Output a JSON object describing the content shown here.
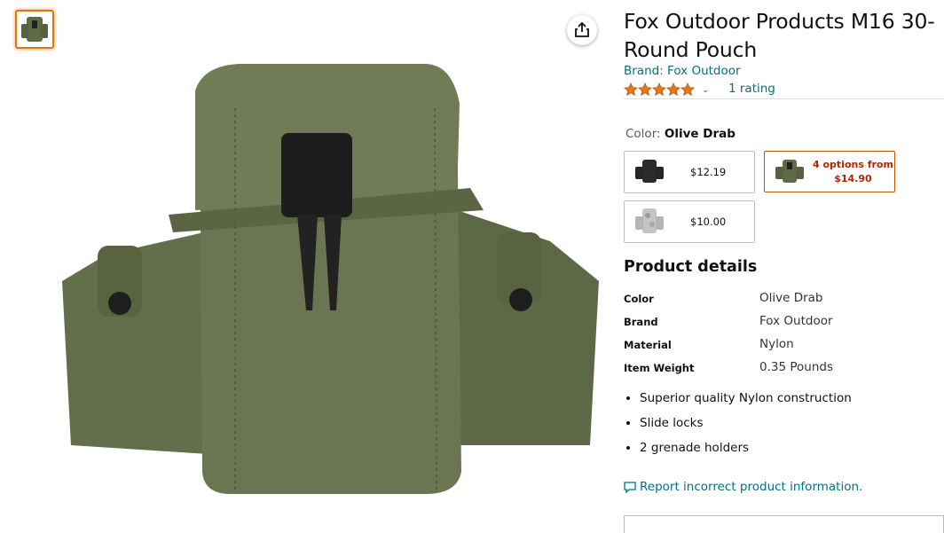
{
  "product": {
    "title": "Fox Outdoor Products M16 30-Round Pouch",
    "brand_link": "Brand: Fox Outdoor",
    "rating_value": 5,
    "rating_link": "1 rating"
  },
  "color_selection": {
    "label": "Color: ",
    "value": "Olive Drab"
  },
  "swatches": [
    {
      "price": "$12.19",
      "color": "#2b2b2b"
    },
    {
      "options_line1": "4 options from",
      "options_line2": "$14.90",
      "selected": true,
      "color": "#5f6a48"
    },
    {
      "price": "$10.00",
      "color": "#bfbfbf"
    }
  ],
  "details": {
    "heading": "Product details",
    "rows": [
      {
        "key": "Color",
        "value": "Olive Drab"
      },
      {
        "key": "Brand",
        "value": "Fox Outdoor"
      },
      {
        "key": "Material",
        "value": "Nylon"
      },
      {
        "key": "Item Weight",
        "value": "0.35 Pounds"
      }
    ]
  },
  "bullets": [
    "Superior quality Nylon construction",
    "Slide locks",
    "2 grenade holders"
  ],
  "report_link": "Report incorrect product information.",
  "colors": {
    "link": "#007185",
    "star": "#de7921",
    "selected_border": "#c45500",
    "price_highlight": "#b12704",
    "pouch": "#6b7551"
  },
  "icons": {
    "share": "share-icon",
    "report": "comment-icon",
    "chevron": "chevron-down-icon",
    "star": "star-icon"
  }
}
